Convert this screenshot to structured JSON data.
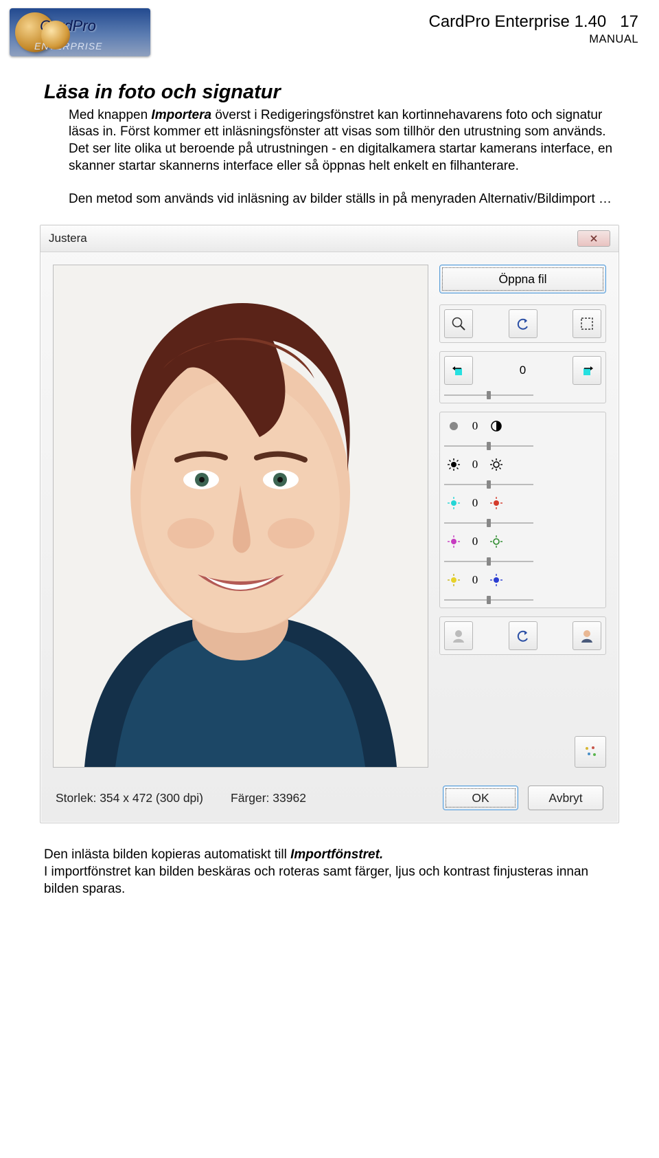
{
  "header": {
    "logo_text1": "CardPro",
    "logo_text2": "ENTERPRISE",
    "doc_title": "CardPro Enterprise 1.40",
    "page_num": "17",
    "manual": "MANUAL"
  },
  "section": {
    "heading": "Läsa in foto och signatur",
    "para1_a": "Med knappen ",
    "para1_em": "Importera",
    "para1_b": " överst i Redigeringsfönstret kan kortinnehavarens foto och signatur läsas in. Först kommer ett inläsningsfönster att visas som tillhör den utrustning som används. Det ser lite olika ut beroende på utrustningen - en digitalkamera startar kamerans interface, en skanner startar skannerns interface eller så öppnas helt enkelt en filhanterare.",
    "para2": "Den metod som används vid inläsning av bilder ställs in på menyraden Alternativ/Bildimport …"
  },
  "dialog": {
    "title": "Justera",
    "open_file": "Öppna fil",
    "rotate_values": {
      "left": "0",
      "right": "0"
    },
    "adjust": {
      "bright_contrast": "0",
      "exposure": "0",
      "cyanred": "0",
      "magentagreen": "0",
      "yellowblue": "0"
    },
    "status_size_label": "Storlek: ",
    "status_size_value": "354 x 472 (300 dpi)",
    "status_colors_label": "Färger: ",
    "status_colors_value": "33962",
    "ok": "OK",
    "cancel": "Avbryt"
  },
  "footer": {
    "p1_a": "Den inlästa bilden kopieras automatiskt till ",
    "p1_em": "Importfönstret.",
    "p2": "I importfönstret kan bilden beskäras och roteras samt färger, ljus och kontrast finjusteras innan bilden sparas."
  }
}
